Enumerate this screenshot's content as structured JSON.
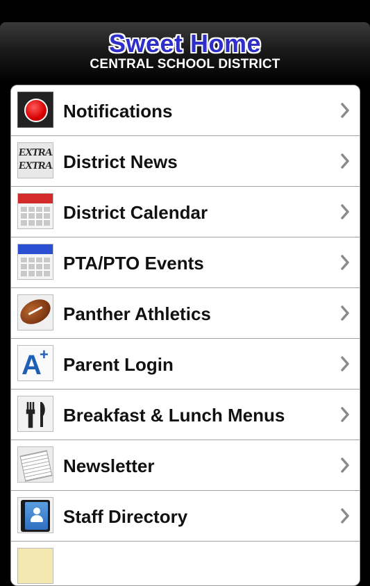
{
  "header": {
    "title": "Sweet Home",
    "subtitle": "CENTRAL SCHOOL DISTRICT"
  },
  "menu": {
    "items": [
      {
        "label": "Notifications",
        "icon": "notification-icon"
      },
      {
        "label": "District News",
        "icon": "newspaper-extra-icon"
      },
      {
        "label": "District Calendar",
        "icon": "calendar-icon"
      },
      {
        "label": "PTA/PTO Events",
        "icon": "calendar-icon"
      },
      {
        "label": "Panther Athletics",
        "icon": "football-icon"
      },
      {
        "label": "Parent Login",
        "icon": "grade-a-plus-icon"
      },
      {
        "label": "Breakfast & Lunch Menus",
        "icon": "fork-knife-icon"
      },
      {
        "label": "Newsletter",
        "icon": "newsletter-icon"
      },
      {
        "label": "Staff Directory",
        "icon": "contacts-book-icon"
      }
    ]
  },
  "icon_text": {
    "extra_1": "EXTRA!",
    "extra_2": "EXTRA!",
    "grade_letter": "A",
    "grade_plus": "+"
  },
  "colors": {
    "title_blue": "#2f2fc8",
    "calendar_red": "#d32a2a",
    "calendar_blue": "#2a4fd0",
    "notification_red": "#d80000"
  }
}
